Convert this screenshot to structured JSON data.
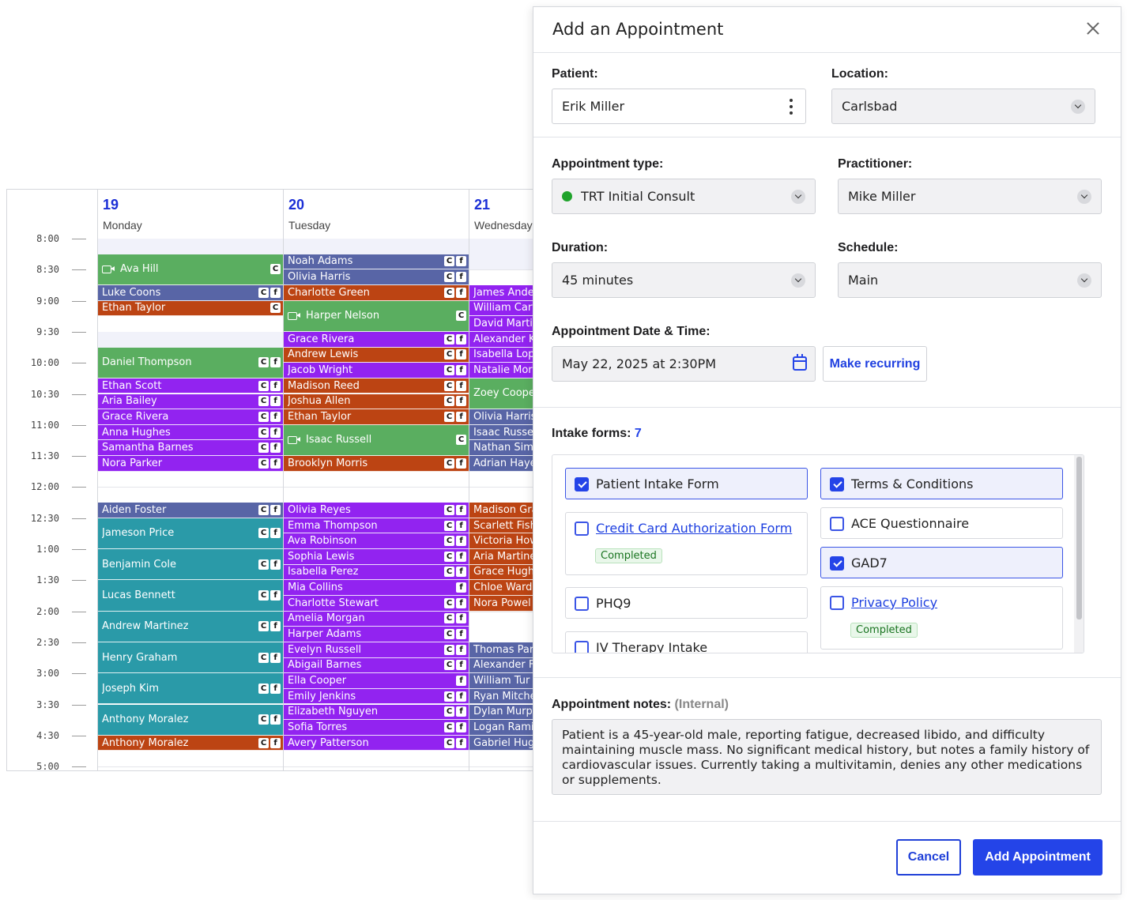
{
  "calendar": {
    "days": [
      {
        "num": "19",
        "name": "Monday"
      },
      {
        "num": "20",
        "name": "Tuesday"
      },
      {
        "num": "21",
        "name": "Wednesday"
      }
    ],
    "times": [
      "8:00",
      "8:30",
      "9:00",
      "9:30",
      "10:00",
      "10:30",
      "11:00",
      "11:30",
      "12:00",
      "12:30",
      "1:00",
      "1:30",
      "2:00",
      "2:30",
      "3:00",
      "3:30",
      "4:30",
      "5:00"
    ],
    "colors": {
      "slate": "#5865a6",
      "green": "#5aae60",
      "orange": "#bc4413",
      "purple": "#9223f0",
      "teal": "#2a9aa8"
    },
    "events": {
      "monday": [
        {
          "name": "Ava Hill",
          "color": "green",
          "video": true,
          "badges": "C",
          "row": 1,
          "span": 2
        },
        {
          "name": "Luke Coons",
          "color": "slate",
          "badges": "CF",
          "row": 3,
          "span": 1
        },
        {
          "name": "Ethan Taylor",
          "color": "orange",
          "badges": "C",
          "row": 4,
          "span": 1
        },
        {
          "name": "Daniel Thompson",
          "color": "green",
          "badges": "CF",
          "row": 7,
          "span": 2
        },
        {
          "name": "Ethan Scott",
          "color": "purple",
          "badges": "CF",
          "row": 9,
          "span": 1
        },
        {
          "name": "Aria Bailey",
          "color": "purple",
          "badges": "CF",
          "row": 10,
          "span": 1
        },
        {
          "name": "Grace Rivera",
          "color": "purple",
          "badges": "CF",
          "row": 11,
          "span": 1
        },
        {
          "name": "Anna Hughes",
          "color": "purple",
          "badges": "CF",
          "row": 12,
          "span": 1
        },
        {
          "name": "Samantha Barnes",
          "color": "purple",
          "badges": "CF",
          "row": 13,
          "span": 1
        },
        {
          "name": "Nora Parker",
          "color": "purple",
          "badges": "CF",
          "row": 14,
          "span": 1
        },
        {
          "name": "Aiden Foster",
          "color": "slate",
          "badges": "CF",
          "row": 17,
          "span": 1
        },
        {
          "name": "Jameson Price",
          "color": "teal",
          "badges": "CF",
          "row": 18,
          "span": 2
        },
        {
          "name": "Benjamin Cole",
          "color": "teal",
          "badges": "CF",
          "row": 20,
          "span": 2
        },
        {
          "name": "Lucas Bennett",
          "color": "teal",
          "badges": "CF",
          "row": 22,
          "span": 2
        },
        {
          "name": "Andrew Martinez",
          "color": "teal",
          "badges": "CF",
          "row": 24,
          "span": 2
        },
        {
          "name": "Henry Graham",
          "color": "teal",
          "badges": "CF",
          "row": 26,
          "span": 2
        },
        {
          "name": "Joseph Kim",
          "color": "teal",
          "badges": "CF",
          "row": 28,
          "span": 2
        },
        {
          "name": "Anthony Moralez",
          "color": "teal",
          "badges": "CF",
          "row": 30,
          "span": 2
        },
        {
          "name": "Anthony Moralez",
          "color": "orange",
          "badges": "CF",
          "row": 32,
          "span": 1
        }
      ],
      "tuesday": [
        {
          "name": "Noah Adams",
          "color": "slate",
          "badges": "CF",
          "row": 1,
          "span": 1
        },
        {
          "name": "Olivia Harris",
          "color": "slate",
          "badges": "CF",
          "row": 2,
          "span": 1
        },
        {
          "name": "Charlotte Green",
          "color": "orange",
          "badges": "CF",
          "row": 3,
          "span": 1
        },
        {
          "name": "Harper Nelson",
          "color": "green",
          "video": true,
          "badges": "C",
          "row": 4,
          "span": 2
        },
        {
          "name": "Grace Rivera",
          "color": "purple",
          "badges": "CF",
          "row": 6,
          "span": 1
        },
        {
          "name": "Andrew Lewis",
          "color": "orange",
          "badges": "CF",
          "row": 7,
          "span": 1
        },
        {
          "name": "Jacob Wright",
          "color": "purple",
          "badges": "CF",
          "row": 8,
          "span": 1
        },
        {
          "name": "Madison Reed",
          "color": "orange",
          "badges": "CF",
          "row": 9,
          "span": 1
        },
        {
          "name": "Joshua Allen",
          "color": "orange",
          "badges": "CF",
          "row": 10,
          "span": 1
        },
        {
          "name": "Ethan Taylor",
          "color": "orange",
          "badges": "CF",
          "row": 11,
          "span": 1
        },
        {
          "name": "Isaac Russell",
          "color": "green",
          "video": true,
          "badges": "C",
          "row": 12,
          "span": 2
        },
        {
          "name": "Brooklyn Morris",
          "color": "orange",
          "badges": "CF",
          "row": 14,
          "span": 1
        },
        {
          "name": "Olivia Reyes",
          "color": "purple",
          "badges": "CF",
          "row": 17,
          "span": 1
        },
        {
          "name": "Emma Thompson",
          "color": "purple",
          "badges": "CF",
          "row": 18,
          "span": 1
        },
        {
          "name": "Ava Robinson",
          "color": "purple",
          "badges": "CF",
          "row": 19,
          "span": 1
        },
        {
          "name": "Sophia Lewis",
          "color": "purple",
          "badges": "CF",
          "row": 20,
          "span": 1
        },
        {
          "name": "Isabella Perez",
          "color": "purple",
          "badges": "CF",
          "row": 21,
          "span": 1
        },
        {
          "name": "Mia Collins",
          "color": "purple",
          "badges": "F",
          "row": 22,
          "span": 1
        },
        {
          "name": "Charlotte Stewart",
          "color": "purple",
          "badges": "CF",
          "row": 23,
          "span": 1
        },
        {
          "name": "Amelia Morgan",
          "color": "purple",
          "badges": "CF",
          "row": 24,
          "span": 1
        },
        {
          "name": "Harper Adams",
          "color": "purple",
          "badges": "CF",
          "row": 25,
          "span": 1
        },
        {
          "name": "Evelyn Russell",
          "color": "purple",
          "badges": "CF",
          "row": 26,
          "span": 1
        },
        {
          "name": "Abigail Barnes",
          "color": "purple",
          "badges": "CF",
          "row": 27,
          "span": 1
        },
        {
          "name": "Ella Cooper",
          "color": "purple",
          "badges": "F",
          "row": 28,
          "span": 1
        },
        {
          "name": "Emily Jenkins",
          "color": "purple",
          "badges": "CF",
          "row": 29,
          "span": 1
        },
        {
          "name": "Elizabeth Nguyen",
          "color": "purple",
          "badges": "CF",
          "row": 30,
          "span": 1
        },
        {
          "name": "Sofia Torres",
          "color": "purple",
          "badges": "CF",
          "row": 31,
          "span": 1
        },
        {
          "name": "Avery Patterson",
          "color": "purple",
          "badges": "CF",
          "row": 32,
          "span": 1
        }
      ],
      "wednesday": [
        {
          "name": "James Ande",
          "color": "purple",
          "row": 3,
          "span": 1
        },
        {
          "name": "William Cart",
          "color": "purple",
          "row": 4,
          "span": 1
        },
        {
          "name": "David Marti",
          "color": "purple",
          "row": 5,
          "span": 1
        },
        {
          "name": "Alexander K",
          "color": "purple",
          "row": 6,
          "span": 1
        },
        {
          "name": "Isabella Lop",
          "color": "purple",
          "row": 7,
          "span": 1
        },
        {
          "name": "Natalie Mor",
          "color": "purple",
          "row": 8,
          "span": 1
        },
        {
          "name": "Zoey Coope",
          "color": "green",
          "row": 9,
          "span": 2
        },
        {
          "name": "Olivia Harris",
          "color": "slate",
          "row": 11,
          "span": 1
        },
        {
          "name": "Isaac Russell",
          "color": "slate",
          "row": 12,
          "span": 1
        },
        {
          "name": "Nathan Sim",
          "color": "slate",
          "row": 13,
          "span": 1
        },
        {
          "name": "Adrian Haye",
          "color": "slate",
          "row": 14,
          "span": 1
        },
        {
          "name": "Madison Gra",
          "color": "orange",
          "row": 17,
          "span": 1
        },
        {
          "name": "Scarlett Fish",
          "color": "orange",
          "row": 18,
          "span": 1
        },
        {
          "name": "Victoria How",
          "color": "orange",
          "row": 19,
          "span": 1
        },
        {
          "name": "Aria Martine",
          "color": "orange",
          "row": 20,
          "span": 1
        },
        {
          "name": "Grace Hugh",
          "color": "orange",
          "row": 21,
          "span": 1
        },
        {
          "name": "Chloe Ward",
          "color": "orange",
          "row": 22,
          "span": 1
        },
        {
          "name": "Nora Powel",
          "color": "orange",
          "row": 23,
          "span": 1
        },
        {
          "name": "Thomas Par",
          "color": "slate",
          "row": 26,
          "span": 1
        },
        {
          "name": "Alexander F",
          "color": "slate",
          "row": 27,
          "span": 1
        },
        {
          "name": "William Tur",
          "color": "slate",
          "row": 28,
          "span": 1
        },
        {
          "name": "Ryan Mitche",
          "color": "slate",
          "row": 29,
          "span": 1
        },
        {
          "name": "Dylan Murp",
          "color": "slate",
          "row": 30,
          "span": 1
        },
        {
          "name": "Logan Rami",
          "color": "slate",
          "row": 31,
          "span": 1
        },
        {
          "name": "Gabriel Hug",
          "color": "slate",
          "row": 32,
          "span": 1
        }
      ]
    }
  },
  "modal": {
    "title": "Add an Appointment",
    "close_icon": "close-icon",
    "patient_label": "Patient:",
    "patient_value": "Erik Miller",
    "location_label": "Location:",
    "location_value": "Carlsbad",
    "appt_type_label": "Appointment type:",
    "appt_type_value": "TRT Initial Consult",
    "appt_type_color": "#1fa32b",
    "practitioner_label": "Practitioner:",
    "practitioner_value": "Mike Miller",
    "duration_label": "Duration:",
    "duration_value": "45 minutes",
    "schedule_label": "Schedule:",
    "schedule_value": "Main",
    "datetime_label": "Appointment Date & Time:",
    "datetime_value": "May 22, 2025 at 2:30PM",
    "recurring_label": "Make recurring",
    "intake_label": "Intake forms:",
    "intake_count": "7",
    "forms": [
      {
        "label": "Patient Intake Form",
        "checked": true,
        "link": false
      },
      {
        "label": "Terms & Conditions",
        "checked": true,
        "link": false
      },
      {
        "label": "Credit Card Authorization Form",
        "checked": false,
        "link": true,
        "status": "Completed"
      },
      {
        "label": "ACE Questionnaire",
        "checked": false,
        "link": false
      },
      {
        "label": "GAD7",
        "checked": true,
        "link": false
      },
      {
        "label": "PHQ9",
        "checked": false,
        "link": false
      },
      {
        "label": "Privacy Policy",
        "checked": false,
        "link": true,
        "status": "Completed"
      },
      {
        "label": "IV Therapy Intake",
        "checked": false,
        "link": false
      }
    ],
    "notes_label": "Appointment notes:",
    "notes_internal": "(Internal)",
    "notes_value": "Patient is a 45-year-old male, reporting fatigue, decreased libido, and difficulty maintaining muscle mass. No significant medical history, but notes a family history of cardiovascular issues. Currently taking a multivitamin, denies any other medications or supplements.",
    "cancel_label": "Cancel",
    "submit_label": "Add Appointment"
  }
}
